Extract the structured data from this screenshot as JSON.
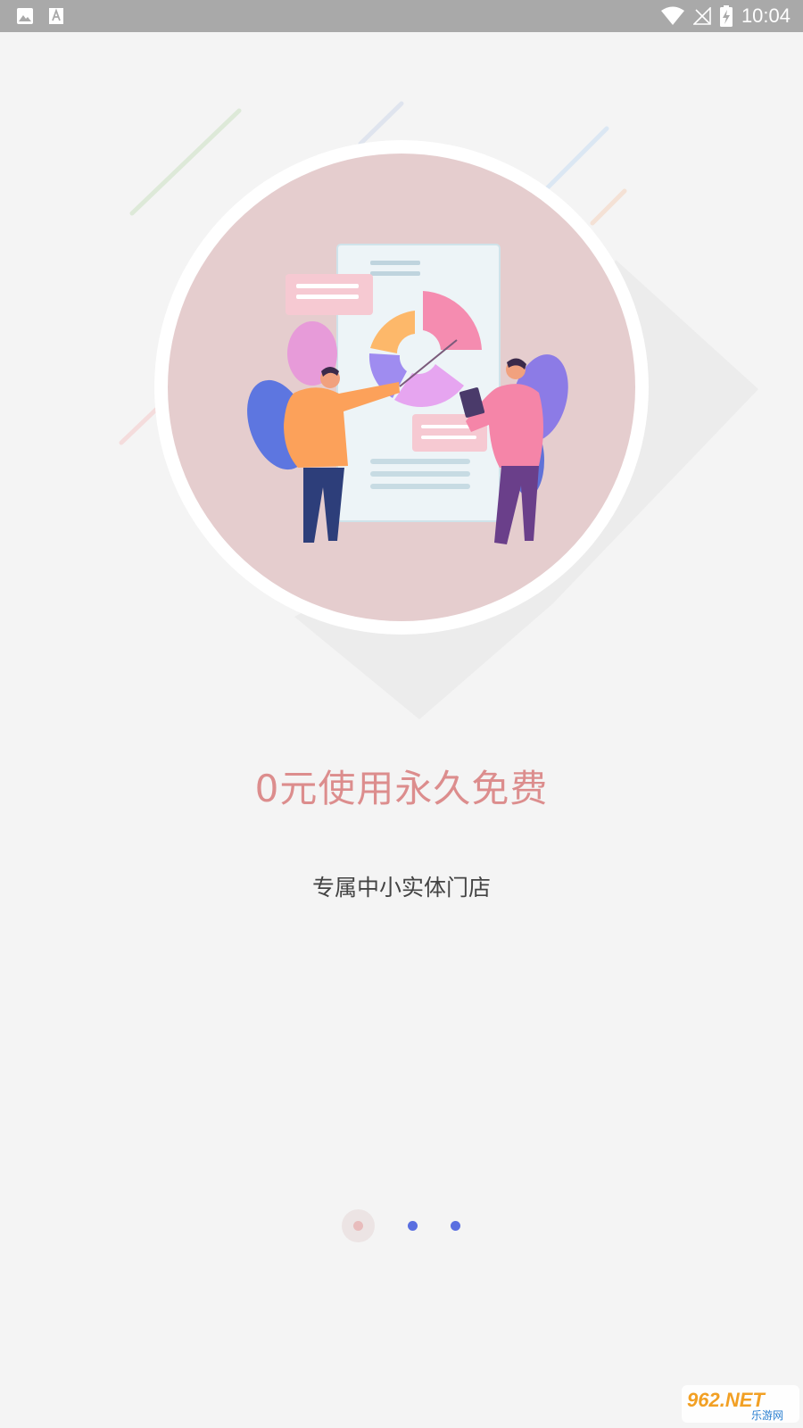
{
  "status_bar": {
    "time": "10:04",
    "left_icons": [
      "image-icon",
      "font-a-icon"
    ],
    "right_icons": [
      "wifi-icon",
      "no-signal-icon",
      "battery-charging-icon"
    ]
  },
  "onboarding": {
    "headline": "0元使用永久免费",
    "subtitle": "专属中小实体门店",
    "pager": {
      "total": 3,
      "active_index": 0
    }
  },
  "watermark": {
    "brand": "962.NET",
    "caption": "乐游网"
  },
  "colors": {
    "status_bar": "#a9a9a9",
    "background": "#f4f4f4",
    "headline": "#dc8d8d",
    "subtitle": "#444444",
    "circle_fill": "#e5cdce",
    "dot_active": "#e8bcbc",
    "dot_inactive": "#5a6fe0"
  }
}
